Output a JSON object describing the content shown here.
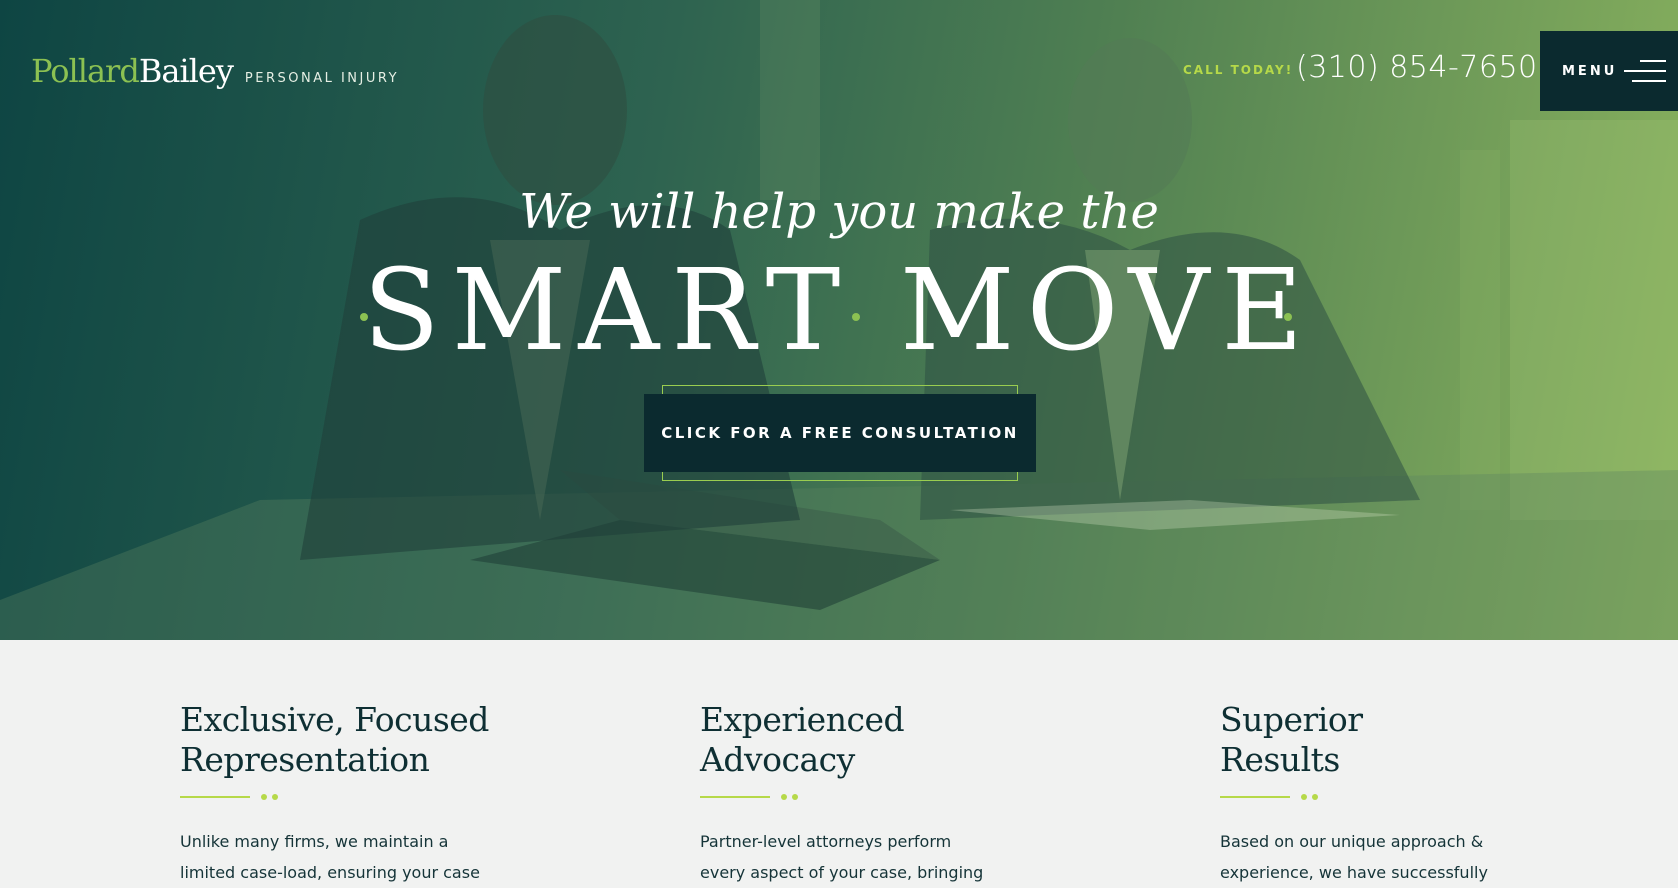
{
  "brand": {
    "name_part1": "Pollard",
    "name_part2": "Bailey",
    "tagline": "PERSONAL INJURY",
    "accent_color": "#8cc152",
    "dark_color": "#0b2a2f"
  },
  "header": {
    "call_label": "CALL TODAY!",
    "phone": "(310) 854-7650",
    "menu_label": "MENU"
  },
  "hero": {
    "tagline": "We will help you make the",
    "headline": "SMART MOVE",
    "cta_label": "CLICK FOR A FREE CONSULTATION"
  },
  "features": [
    {
      "title_line1": "Exclusive, Focused",
      "title_line2": "Representation",
      "text_line1": "Unlike many firms, we maintain a",
      "text_line2": "limited case-load, ensuring your case"
    },
    {
      "title_line1": "Experienced",
      "title_line2": "Advocacy",
      "text_line1": "Partner-level attorneys perform",
      "text_line2": "every aspect of your case, bringing"
    },
    {
      "title_line1": "Superior",
      "title_line2": "Results",
      "text_line1": "Based on our unique approach &",
      "text_line2": "experience, we have successfully"
    }
  ]
}
